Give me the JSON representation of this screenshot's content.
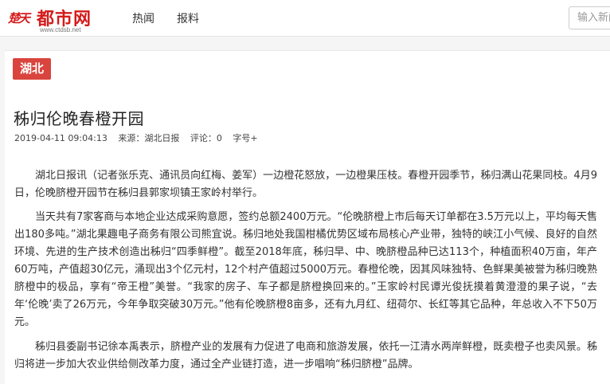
{
  "header": {
    "logo_seal": "楚天",
    "logo_main": "都市网",
    "logo_url": "www.ctdsb.net",
    "nav": [
      "热闻",
      "报料"
    ],
    "search_placeholder": "输入新闻"
  },
  "article": {
    "region_tag": "湖北",
    "title": "秭归伦晚春橙开园",
    "meta": {
      "datetime": "2019-04-11 09:04:13",
      "source": "来源：湖北日报",
      "comments": "评论：0",
      "font_size": "字号+"
    },
    "paragraphs": [
      "湖北日报讯（记者张乐克、通讯员向红梅、姜军）一边橙花怒放，一边橙果压枝。春橙开园季节，秭归满山花果同枝。4月9日，伦晚脐橙开园节在秭归县郭家坝镇王家岭村举行。",
      "当天共有7家客商与本地企业达成采购意愿，签约总额2400万元。“伦晚脐橙上市后每天订单都在3.5万元以上，平均每天售出180多吨。”湖北果趣电子商务有限公司熊宜说。秭归地处我国柑橘优势区域布局核心产业带，独特的峡江小气候、良好的自然环境、先进的生产技术创造出秭归“四季鲜橙”。截至2018年底，秭归早、中、晚脐橙品种已达113个，种植面积40万亩，年产60万吨，产值超30亿元，涌现出3个亿元村，12个村产值超过5000万元。春橙伦晚，因其风味独特、色鲜果美被誉为秭归晚熟脐橙中的极品，享有“帝王橙”美誉。“我家的房子、车子都是脐橙换回来的。”王家岭村民谭光俊抚摸着黄澄澄的果子说，“去年‘伦晚’卖了26万元，今年争取突破30万元。”他有伦晚脐橙8亩多，还有九月红、纽荷尔、长红等其它品种，年总收入不下50万元。",
      "秭归县委副书记徐本禹表示，脐橙产业的发展有力促进了电商和旅游发展，依托一江清水两岸鲜橙，既卖橙子也卖风景。秭归将进一步加大农业供给侧改革力度，通过全产业链打造，进一步唱响“秭归脐橙”品牌。"
    ]
  },
  "colors": {
    "brand_red": "#d41b1b",
    "tag_red": "#d9453e"
  }
}
